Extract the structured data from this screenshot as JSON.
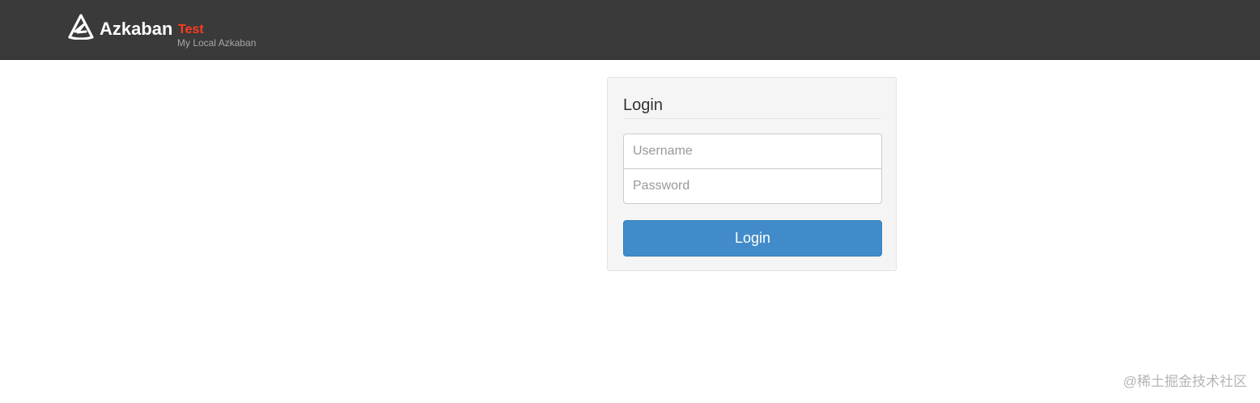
{
  "header": {
    "logo_icon": "azkaban-logo-icon",
    "app_name": "Azkaban",
    "environment": "Test",
    "subtitle": "My Local Azkaban",
    "background_color": "#3a3a3a",
    "environment_color": "#ff3b1f"
  },
  "login": {
    "title": "Login",
    "username_placeholder": "Username",
    "username_value": "",
    "password_placeholder": "Password",
    "password_value": "",
    "submit_label": "Login",
    "button_color": "#428bca"
  },
  "watermark": {
    "text": "@稀土掘金技术社区"
  }
}
